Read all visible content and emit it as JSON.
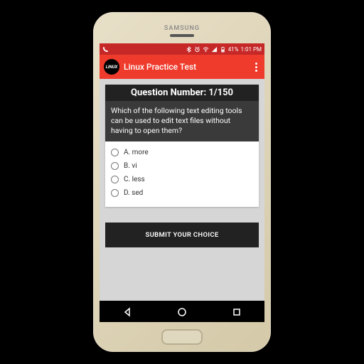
{
  "device": {
    "brand": "SAMSUNG"
  },
  "statusbar": {
    "battery": "41%",
    "time": "1:01 PM"
  },
  "appbar": {
    "logo_text": "LINUX",
    "title": "Linux Practice Test"
  },
  "quiz": {
    "header": "Question Number: 1/150",
    "question": "Which of the following text editing tools can be used to edit text files without having to open them?",
    "options": [
      {
        "label": "A. more"
      },
      {
        "label": "B. vi"
      },
      {
        "label": "C. less"
      },
      {
        "label": "D. sed"
      }
    ],
    "submit_label": "SUBMIT YOUR CHOICE"
  }
}
